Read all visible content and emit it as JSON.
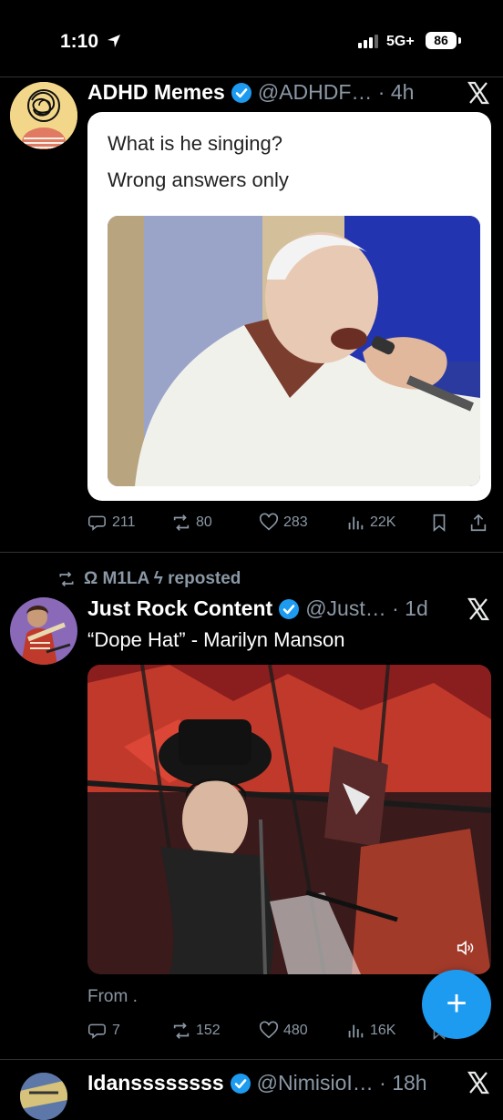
{
  "status_bar": {
    "time": "1:10",
    "network": "5G+",
    "battery": "86"
  },
  "tweets": [
    {
      "display_name": "ADHD Memes",
      "handle_time": "@ADHDF… · 4h",
      "meme_text_line1": "What is he singing?",
      "meme_text_line2": "Wrong answers only",
      "replies": "211",
      "reposts": "80",
      "likes": "283",
      "views": "22K"
    },
    {
      "repost_by": "Ω M1LA ϟ reposted",
      "display_name": "Just Rock Content",
      "handle_time": "@Just… · 1d",
      "text": "“Dope Hat” - Marilyn Manson",
      "from_text": "From .",
      "replies": "7",
      "reposts": "152",
      "likes": "480",
      "views": "16K"
    },
    {
      "display_name": "Idanssssssss",
      "handle_time": "@NimisioI… · 18h"
    }
  ],
  "colors": {
    "accent": "#1d9bf0",
    "muted": "#8b98a5",
    "background": "#000000"
  }
}
